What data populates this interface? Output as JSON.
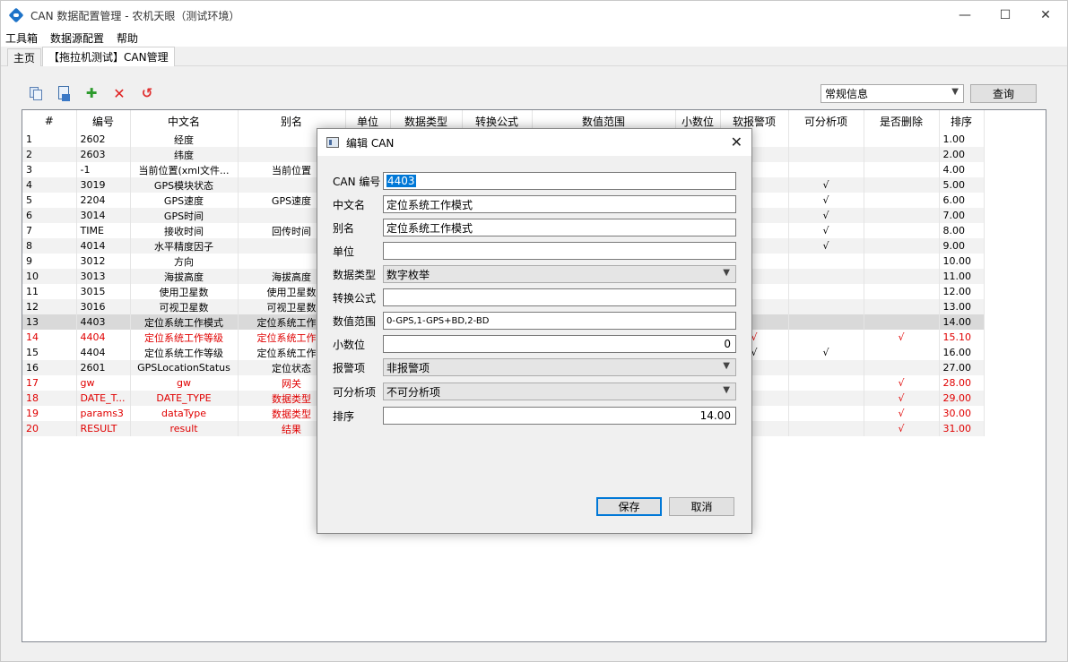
{
  "window": {
    "title": "CAN 数据配置管理 - 农机天眼（测试环境）",
    "controls": {
      "minimize": "—",
      "maximize": "☐",
      "close": "✕"
    }
  },
  "menu": [
    "工具箱",
    "数据源配置",
    "帮助"
  ],
  "tabs": [
    {
      "label": "主页",
      "active": false
    },
    {
      "label": "【拖拉机测试】CAN管理",
      "active": true
    }
  ],
  "toolbar": {
    "icons": [
      "copy-icon",
      "export-icon",
      "add-icon",
      "delete-icon",
      "undo-icon"
    ],
    "add_glyph": "✚",
    "delete_glyph": "✕",
    "undo_glyph": "↺",
    "filter_value": "常规信息",
    "query_label": "查询"
  },
  "grid": {
    "sort_glyph": "^",
    "headers": [
      "#",
      "编号",
      "中文名",
      "别名",
      "单位",
      "数据类型",
      "转换公式",
      "数值范围",
      "小数位",
      "软报警项",
      "可分析项",
      "是否删除",
      "排序"
    ],
    "rows": [
      {
        "cells": [
          "1",
          "2602",
          "经度",
          "",
          "",
          "",
          "",
          "",
          "",
          "",
          "",
          "",
          "1.00"
        ],
        "style": ""
      },
      {
        "cells": [
          "2",
          "2603",
          "纬度",
          "",
          "",
          "",
          "",
          "",
          "",
          "",
          "",
          "",
          "2.00"
        ],
        "style": "alt"
      },
      {
        "cells": [
          "3",
          "-1",
          "当前位置(xml文件...",
          "当前位置",
          "",
          "",
          "",
          "",
          "",
          "",
          "",
          "",
          "4.00"
        ],
        "style": ""
      },
      {
        "cells": [
          "4",
          "3019",
          "GPS模块状态",
          "",
          "",
          "",
          "",
          "",
          "",
          "",
          "√",
          "",
          "5.00"
        ],
        "style": "alt"
      },
      {
        "cells": [
          "5",
          "2204",
          "GPS速度",
          "GPS速度",
          "",
          "",
          "",
          "",
          "",
          "",
          "√",
          "",
          "6.00"
        ],
        "style": ""
      },
      {
        "cells": [
          "6",
          "3014",
          "GPS时间",
          "",
          "",
          "",
          "",
          "",
          "",
          "",
          "√",
          "",
          "7.00"
        ],
        "style": "alt"
      },
      {
        "cells": [
          "7",
          "TIME",
          "接收时间",
          "回传时间",
          "",
          "",
          "",
          "",
          "",
          "",
          "√",
          "",
          "8.00"
        ],
        "style": ""
      },
      {
        "cells": [
          "8",
          "4014",
          "水平精度因子",
          "",
          "",
          "",
          "",
          "",
          "",
          "",
          "√",
          "",
          "9.00"
        ],
        "style": "alt"
      },
      {
        "cells": [
          "9",
          "3012",
          "方向",
          "",
          "",
          "",
          "",
          "",
          "",
          "",
          "",
          "",
          "10.00"
        ],
        "style": ""
      },
      {
        "cells": [
          "10",
          "3013",
          "海拔高度",
          "海拔高度",
          "",
          "",
          "",
          "",
          "",
          "",
          "",
          "",
          "11.00"
        ],
        "style": "alt"
      },
      {
        "cells": [
          "11",
          "3015",
          "使用卫星数",
          "使用卫星数",
          "",
          "",
          "",
          "",
          "",
          "",
          "",
          "",
          "12.00"
        ],
        "style": ""
      },
      {
        "cells": [
          "12",
          "3016",
          "可视卫星数",
          "可视卫星数",
          "",
          "",
          "",
          "",
          "",
          "",
          "",
          "",
          "13.00"
        ],
        "style": "alt"
      },
      {
        "cells": [
          "13",
          "4403",
          "定位系统工作模式",
          "定位系统工作模",
          "",
          "",
          "",
          "",
          "",
          "",
          "",
          "",
          "14.00"
        ],
        "style": "sel"
      },
      {
        "cells": [
          "14",
          "4404",
          "定位系统工作等级",
          "定位系统工作等",
          "",
          "",
          "",
          "",
          "",
          "√",
          "",
          "√",
          "15.10"
        ],
        "style": "red"
      },
      {
        "cells": [
          "15",
          "4404",
          "定位系统工作等级",
          "定位系统工作等",
          "",
          "",
          "",
          "",
          "",
          "√",
          "√",
          "",
          "16.00"
        ],
        "style": ""
      },
      {
        "cells": [
          "16",
          "2601",
          "GPSLocationStatus",
          "定位状态",
          "",
          "",
          "",
          "",
          "",
          "",
          "",
          "",
          "27.00"
        ],
        "style": "alt"
      },
      {
        "cells": [
          "17",
          "gw",
          "gw",
          "网关",
          "",
          "",
          "",
          "",
          "",
          "",
          "",
          "√",
          "28.00"
        ],
        "style": "red"
      },
      {
        "cells": [
          "18",
          "DATE_T...",
          "DATE_TYPE",
          "数据类型",
          "",
          "",
          "",
          "",
          "",
          "",
          "",
          "√",
          "29.00"
        ],
        "style": "red alt"
      },
      {
        "cells": [
          "19",
          "params3",
          "dataType",
          "数据类型",
          "",
          "",
          "",
          "",
          "",
          "",
          "",
          "√",
          "30.00"
        ],
        "style": "red"
      },
      {
        "cells": [
          "20",
          "RESULT",
          "result",
          "结果",
          "",
          "",
          "",
          "",
          "",
          "",
          "",
          "√",
          "31.00"
        ],
        "style": "red alt"
      }
    ]
  },
  "dialog": {
    "title": "编辑 CAN",
    "close_glyph": "✕",
    "fields": {
      "can_id": {
        "label": "CAN 编号",
        "value": "4403"
      },
      "cn_name": {
        "label": "中文名",
        "value": "定位系统工作模式"
      },
      "alias": {
        "label": "别名",
        "value": "定位系统工作模式"
      },
      "unit": {
        "label": "单位",
        "value": ""
      },
      "data_type": {
        "label": "数据类型",
        "value": "数字枚举"
      },
      "formula": {
        "label": "转换公式",
        "value": ""
      },
      "range": {
        "label": "数值范围",
        "value": "0-GPS,1-GPS+BD,2-BD"
      },
      "decimals": {
        "label": "小数位",
        "value": "0"
      },
      "alarm": {
        "label": "报警项",
        "value": "非报警项"
      },
      "analyzable": {
        "label": "可分析项",
        "value": "不可分析项"
      },
      "sort": {
        "label": "排序",
        "value": "14.00"
      }
    },
    "save_label": "保存",
    "cancel_label": "取消"
  },
  "colors": {
    "accent": "#0078d7",
    "deleted_row": "#e00000",
    "selected_row": "#d9d9d9"
  }
}
